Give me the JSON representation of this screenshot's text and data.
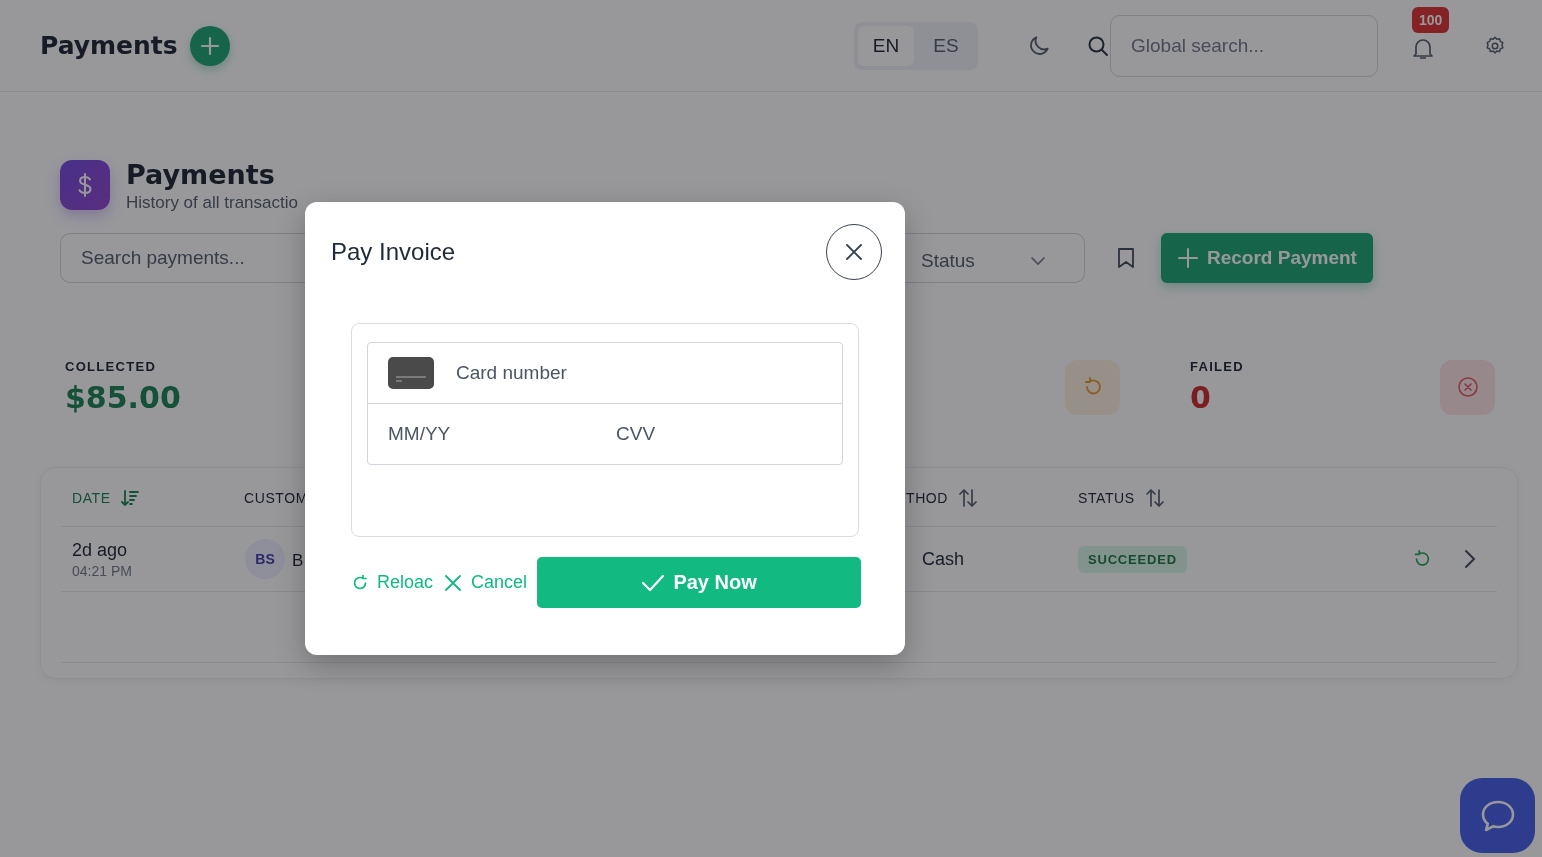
{
  "header": {
    "title": "Payments",
    "languages": [
      {
        "label": "EN",
        "selected": true
      },
      {
        "label": "ES",
        "selected": false
      }
    ],
    "search": {
      "placeholder": "Global search..."
    },
    "notification_badge": "100"
  },
  "page": {
    "title": "Payments",
    "subtitle": "History of all transactio"
  },
  "toolbar": {
    "search": {
      "placeholder": "Search payments..."
    },
    "status_filter": {
      "placeholder": "Status"
    },
    "record_button": "Record Payment"
  },
  "stats": [
    {
      "kind": "collected",
      "label": "COLLECTED",
      "value": "$85.00"
    },
    {
      "kind": "failed",
      "label": "FAILED",
      "value": "0"
    }
  ],
  "table": {
    "columns": [
      {
        "label": "DATE",
        "sort_icon": true,
        "sorted": true
      },
      {
        "label": "CUSTOM",
        "sort_icon": false,
        "sorted": false
      },
      {
        "label": "THOD",
        "sort_icon": true,
        "sorted": false
      },
      {
        "label": "STATUS",
        "sort_icon": true,
        "sorted": false
      }
    ],
    "rows": [
      {
        "date": "2d ago",
        "time": "04:21 PM",
        "initials": "BS",
        "customer": "B",
        "method": "Cash",
        "status": "SUCCEEDED",
        "kind": "succeeded"
      }
    ]
  },
  "modal": {
    "title": "Pay Invoice",
    "card_number": {
      "placeholder": "Card number"
    },
    "expiry": {
      "placeholder": "MM/YY"
    },
    "cvv": {
      "placeholder": "CVV"
    },
    "reload": "Reloac",
    "cancel": "Cancel",
    "pay": "Pay Now"
  }
}
